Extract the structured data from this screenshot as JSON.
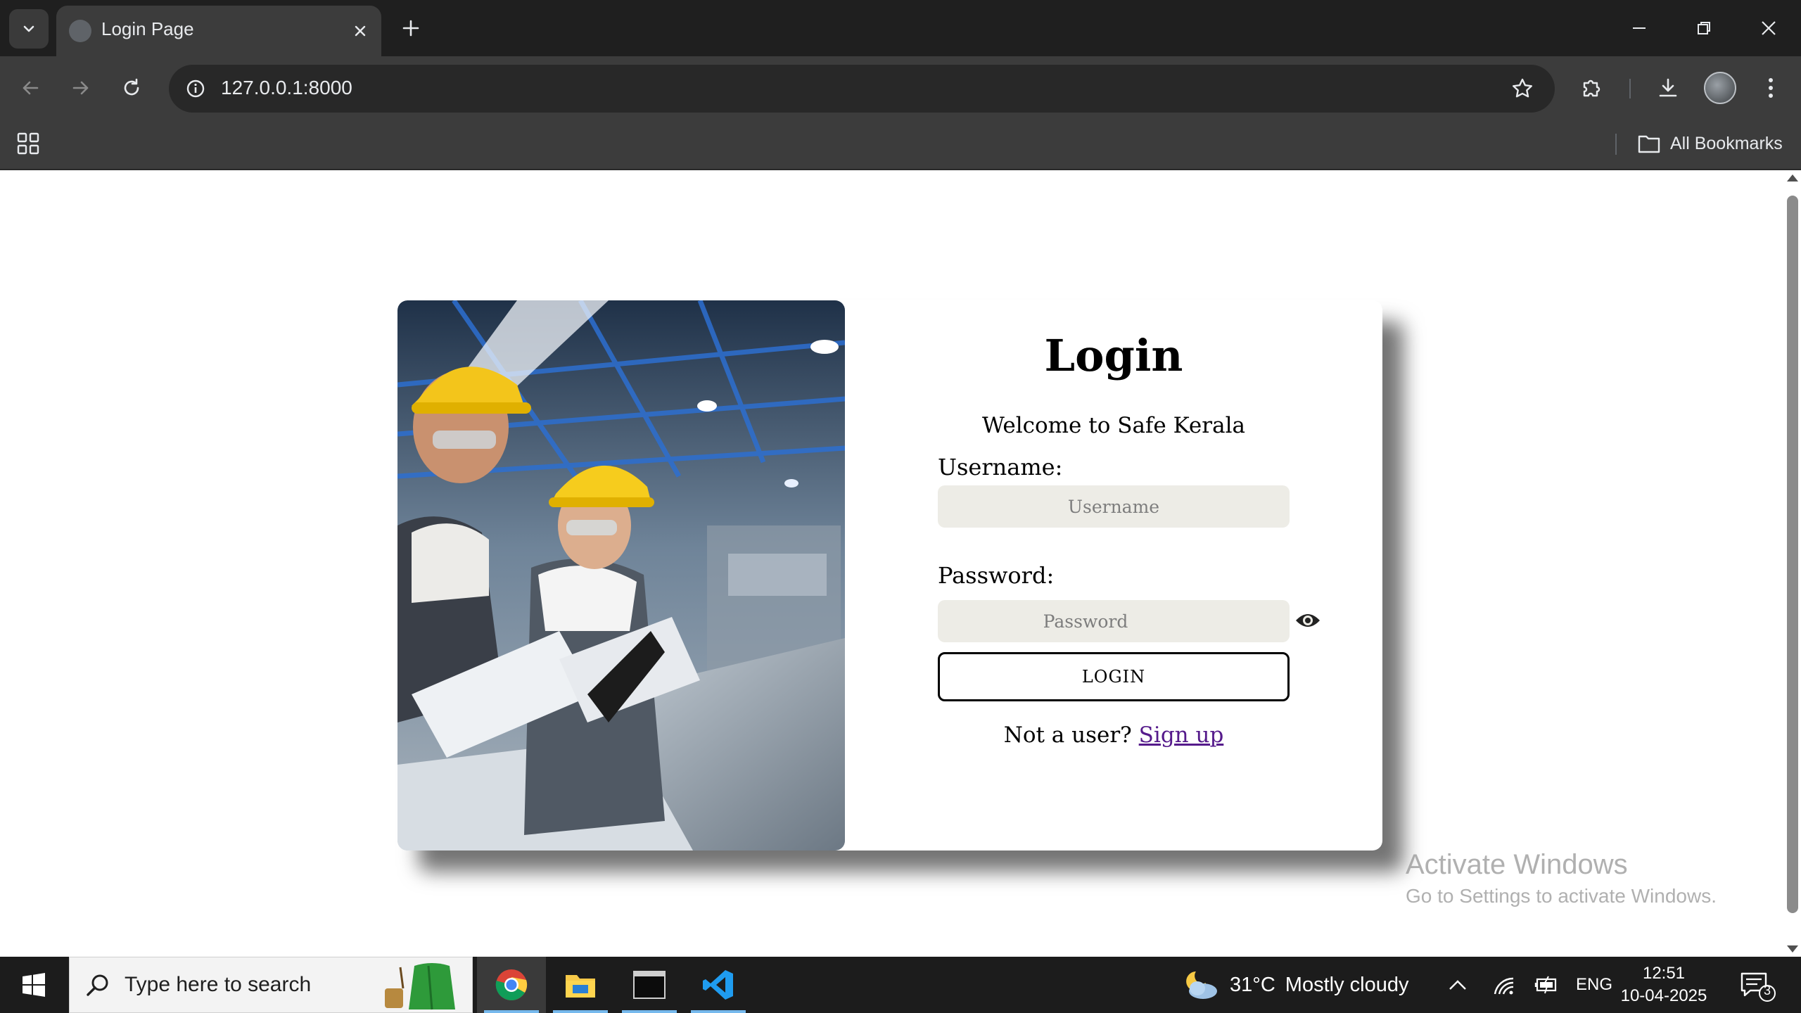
{
  "browser": {
    "tab_title": "Login Page",
    "url": "127.0.0.1:8000",
    "bookmarks_label": "All Bookmarks"
  },
  "page": {
    "title": "Login",
    "welcome": "Welcome to Safe Kerala",
    "username_label": "Username:",
    "username_placeholder": "Username",
    "password_label": "Password:",
    "password_placeholder": "Password",
    "login_button": "LOGIN",
    "signup_prompt": "Not a user?",
    "signup_link": "Sign up"
  },
  "watermark": {
    "title": "Activate Windows",
    "subtitle": "Go to Settings to activate Windows."
  },
  "taskbar": {
    "search_placeholder": "Type here to search",
    "weather_temp": "31°C",
    "weather_desc": "Mostly cloudy",
    "language": "ENG",
    "time": "12:51",
    "date": "10-04-2025",
    "notification_count": "3"
  },
  "colors": {
    "chrome_dark": "#1f1f1f",
    "toolbar": "#3c3c3c",
    "input_bg": "#edece6",
    "link": "#551a8b",
    "taskbar": "#1c1c1c"
  }
}
